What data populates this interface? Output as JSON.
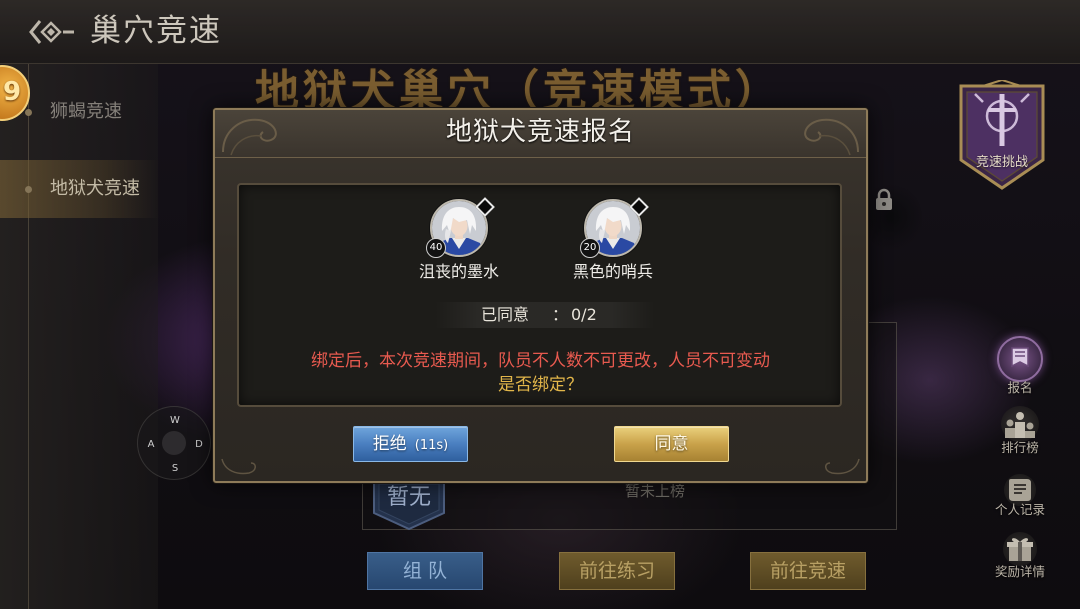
{
  "header": {
    "title": "巢穴竞速",
    "back_icon": "back-arrow-icon"
  },
  "sidebar": {
    "badge": "9",
    "items": [
      {
        "label": "狮蝎竞速",
        "selected": false
      },
      {
        "label": "地狱犬竞速",
        "selected": true
      }
    ]
  },
  "stage": {
    "title": "地狱犬巢穴（竞速模式）",
    "rank_badge": "暂无",
    "rank_status": "暂未上榜",
    "lock_icon": "lock-icon"
  },
  "challenge_emblem": {
    "label": "竞速挑战",
    "icon": "sword-crest-icon"
  },
  "right_menu": [
    {
      "label": "报名",
      "icon": "signup-icon"
    },
    {
      "label": "排行榜",
      "icon": "leaderboard-icon"
    },
    {
      "label": "个人记录",
      "icon": "record-icon"
    },
    {
      "label": "奖励详情",
      "icon": "gift-icon"
    }
  ],
  "movement_pad": {
    "up": "W",
    "left": "A",
    "right": "D",
    "down": "S"
  },
  "bottom_buttons": [
    {
      "label": "组 队"
    },
    {
      "label": "前往练习"
    },
    {
      "label": "前往竞速"
    }
  ],
  "dialog": {
    "title": "地狱犬竞速报名",
    "members": [
      {
        "name": "沮丧的墨水",
        "level": "40"
      },
      {
        "name": "黑色的哨兵",
        "level": "20"
      }
    ],
    "agreed_label": "已同意",
    "agreed_separator": "：",
    "agreed_count": "0/2",
    "warning": "绑定后，本次竞速期间，队员不人数不可更改，人员不可变动",
    "question": "是否绑定？",
    "reject_label": "拒绝",
    "reject_countdown": "(11s)",
    "agree_label": "同意"
  },
  "colors": {
    "accent_gold": "#d4b062",
    "button_blue": "#4a7fc0",
    "warning_red": "#e85a4f",
    "question_gold": "#e2b64a"
  }
}
